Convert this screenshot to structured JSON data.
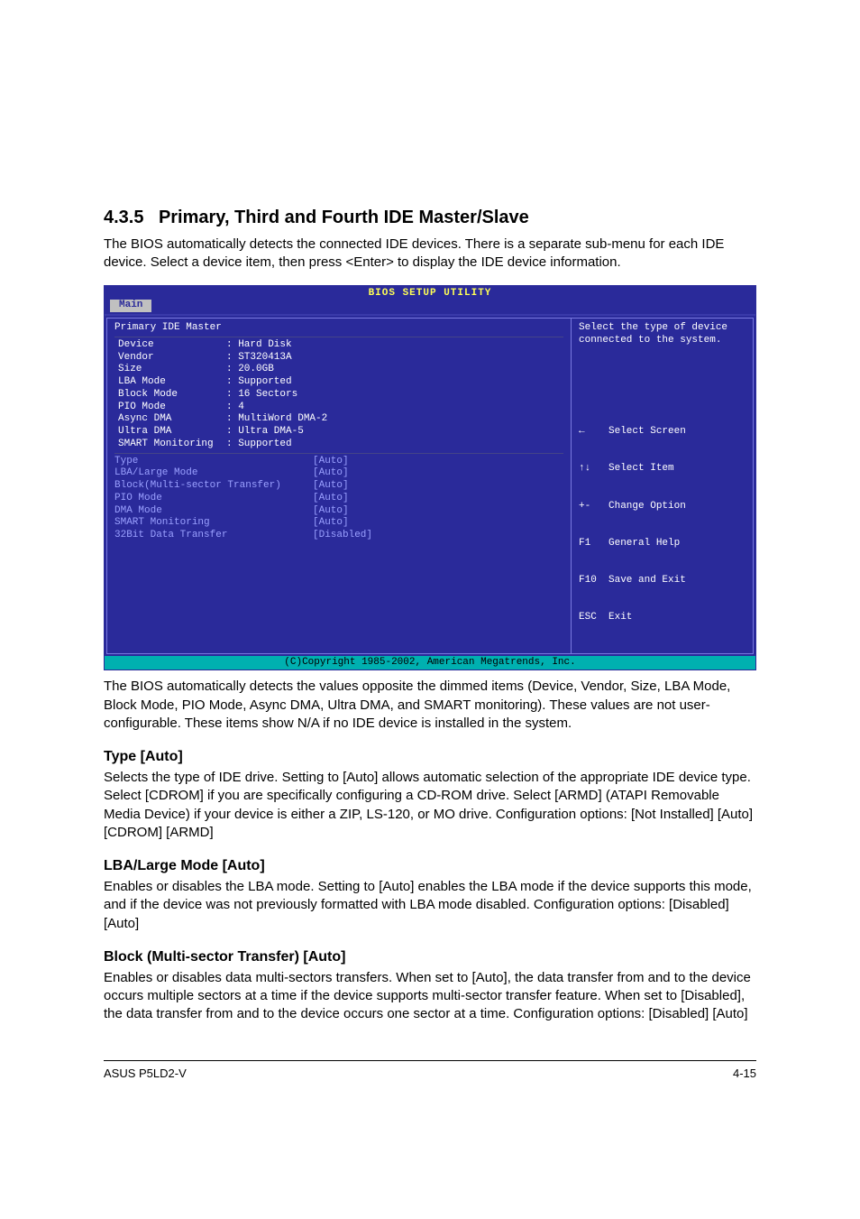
{
  "section": {
    "number": "4.3.5",
    "title": "Primary, Third and Fourth IDE Master/Slave",
    "intro": "The BIOS automatically detects the connected IDE devices. There is a separate sub-menu for each IDE device. Select a device item, then press <Enter> to display the IDE device information."
  },
  "bios": {
    "title": "BIOS SETUP UTILITY",
    "tab": "Main",
    "panel_header": "Primary IDE Master",
    "info": [
      {
        "k": "Device",
        "v": ": Hard Disk"
      },
      {
        "k": "Vendor",
        "v": ": ST320413A"
      },
      {
        "k": "Size",
        "v": ": 20.0GB"
      },
      {
        "k": "LBA Mode",
        "v": ": Supported"
      },
      {
        "k": "Block Mode",
        "v": ": 16 Sectors"
      },
      {
        "k": "PIO Mode",
        "v": ": 4"
      },
      {
        "k": "Async DMA",
        "v": ": MultiWord DMA-2"
      },
      {
        "k": "Ultra DMA",
        "v": ": Ultra DMA-5"
      },
      {
        "k": "SMART Monitoring",
        "v": ": Supported"
      }
    ],
    "settings": [
      {
        "k": "Type",
        "v": "[Auto]"
      },
      {
        "k": "LBA/Large Mode",
        "v": "[Auto]"
      },
      {
        "k": "Block(Multi-sector Transfer)",
        "v": "[Auto]"
      },
      {
        "k": "PIO Mode",
        "v": "[Auto]"
      },
      {
        "k": "DMA Mode",
        "v": "[Auto]"
      },
      {
        "k": "SMART Monitoring",
        "v": "[Auto]"
      },
      {
        "k": "32Bit Data Transfer",
        "v": "[Disabled]"
      }
    ],
    "help": "Select the type of device connected to the system.",
    "nav": [
      "←    Select Screen",
      "↑↓   Select Item",
      "+-   Change Option",
      "F1   General Help",
      "F10  Save and Exit",
      "ESC  Exit"
    ],
    "copyright": "(C)Copyright 1985-2002, American Megatrends, Inc."
  },
  "after_bios": "The BIOS automatically detects the values opposite the dimmed items (Device, Vendor, Size, LBA Mode, Block Mode, PIO Mode, Async DMA, Ultra DMA, and SMART monitoring). These values are not user-configurable. These items show N/A if no IDE device is installed in the system.",
  "type": {
    "hdr": "Type [Auto]",
    "body": "Selects the type of IDE drive. Setting to [Auto] allows automatic selection of the appropriate IDE device type. Select [CDROM] if you are specifically configuring a CD-ROM drive. Select [ARMD] (ATAPI Removable Media Device) if your device is either a ZIP, LS-120, or MO drive. Configuration options: [Not Installed] [Auto] [CDROM] [ARMD]"
  },
  "lba": {
    "hdr": "LBA/Large Mode [Auto]",
    "body": "Enables or disables the LBA mode. Setting to [Auto] enables the LBA mode if the device supports this mode, and if the device was not previously formatted with LBA mode disabled. Configuration options: [Disabled] [Auto]"
  },
  "block": {
    "hdr": "Block (Multi-sector Transfer) [Auto]",
    "body": "Enables or disables data multi-sectors transfers. When set to [Auto], the data transfer from and to the device occurs multiple sectors at a time if the device supports multi-sector transfer feature. When set to [Disabled], the data transfer from and to the device occurs one sector at a time. Configuration options: [Disabled] [Auto]"
  },
  "footer": {
    "left": "ASUS P5LD2-V",
    "right": "4-15"
  }
}
